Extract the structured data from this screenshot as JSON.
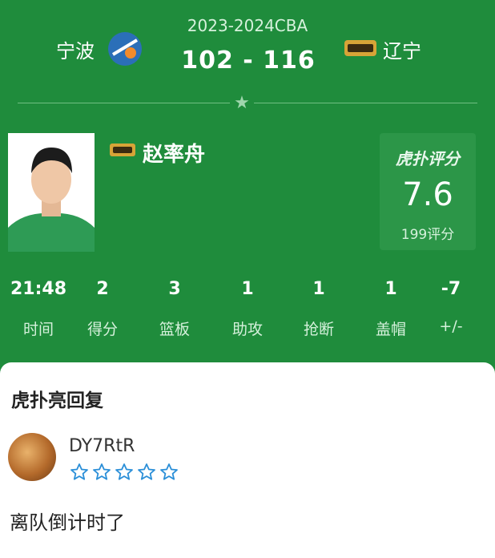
{
  "match": {
    "season": "2023-2024CBA",
    "home_team": "宁波",
    "away_team": "辽宁",
    "score": "102 - 116"
  },
  "player": {
    "name": "赵率舟"
  },
  "rating": {
    "brand": "虎扑评分",
    "value": "7.6",
    "count_label": "199评分"
  },
  "stats": [
    {
      "value": "21:48",
      "label": "时间"
    },
    {
      "value": "2",
      "label": "得分"
    },
    {
      "value": "3",
      "label": "篮板"
    },
    {
      "value": "1",
      "label": "助攻"
    },
    {
      "value": "1",
      "label": "抢断"
    },
    {
      "value": "1",
      "label": "盖帽"
    },
    {
      "value": "-7",
      "label": "+/-"
    }
  ],
  "reply_section": {
    "title": "虎扑亮回复",
    "user": "DY7RtR",
    "user_rating_stars": 0,
    "comment": "离队倒计时了"
  },
  "colors": {
    "background": "#1f8c3c",
    "rating_box": "#2c9648",
    "star_outline": "#2b8fd8"
  }
}
